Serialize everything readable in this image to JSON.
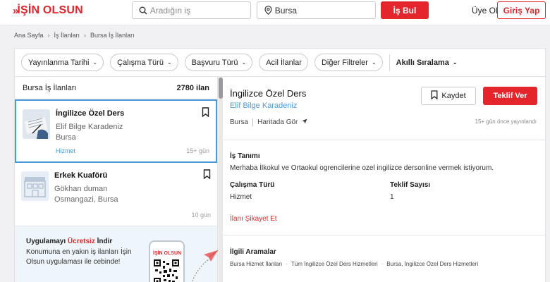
{
  "header": {
    "logo": "İŞİN OLSUN",
    "search_placeholder": "Aradığın iş",
    "location_value": "Bursa",
    "find_button": "İş Bul",
    "member_label": "Üye Ol",
    "login_button": "Giriş Yap"
  },
  "breadcrumb": [
    "Ana Sayfa",
    "İş İlanları",
    "Bursa İş İlanları"
  ],
  "filters": {
    "chips": [
      "Yayınlanma Tarihi",
      "Çalışma Türü",
      "Başvuru Türü",
      "Acil İlanlar",
      "Diğer Filtreler"
    ],
    "sort_label": "Akıllı Sıralama"
  },
  "list": {
    "header_title": "Bursa İş İlanları",
    "count": "2780 ilan",
    "items": [
      {
        "title": "İngilizce Özel Ders",
        "company": "Elif Bilge Karadeniz",
        "location": "Bursa",
        "tag": "Hizmet",
        "age": "15+ gün"
      },
      {
        "title": "Erkek Kuaförü",
        "company": "Gökhan duman",
        "location": "Osmangazi, Bursa",
        "tag": "",
        "age": "10 gün"
      }
    ]
  },
  "promo": {
    "title_pre": "Uygulamayı ",
    "title_red": "Ücretsiz",
    "title_post": " İndir",
    "text": "Konumuna en yakın iş ilanları İşin Olsun uygulaması ile cebinde!",
    "phone_logo": "İŞİN OLSUN"
  },
  "detail": {
    "title": "İngilizce Özel Ders",
    "company": "Elif Bilge Karadeniz",
    "save_button": "Kaydet",
    "offer_button": "Teklif Ver",
    "location": "Bursa",
    "map_link": "Haritada Gör",
    "posted": "15+ gün önce yayınlandı",
    "job_desc_title": "İş Tanımı",
    "job_desc": "Merhaba İlkokul ve Ortaokul ogrencilerine ozel ingilizce dersonline vermek istiyorum.",
    "work_type_label": "Çalışma Türü",
    "work_type_value": "Hizmet",
    "offer_count_label": "Teklif Sayısı",
    "offer_count_value": "1",
    "report_link": "İlanı Şikayet Et",
    "related_title": "İlgili Aramalar",
    "related": [
      "Bursa Hizmet İlanları",
      "Tüm İngilizce Özel Ders Hizmetleri",
      "Bursa, İngilizce Özel Ders Hizmetleri"
    ]
  },
  "colors": {
    "brand_red": "#e4262c",
    "link_blue": "#4a9bd8"
  }
}
